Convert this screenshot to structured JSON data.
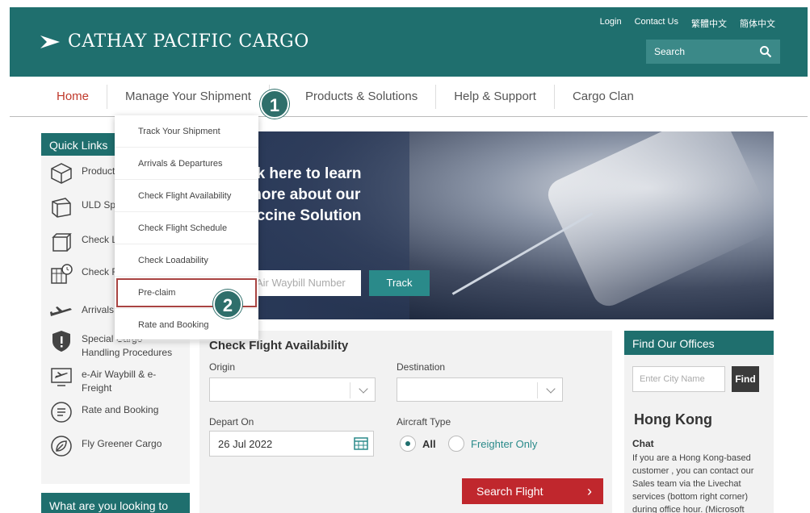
{
  "header": {
    "logo_text": "CATHAY PACIFIC CARGO",
    "top_links": [
      "Login",
      "Contact Us",
      "繁體中文",
      "簡体中文"
    ],
    "search_label": "Search"
  },
  "nav": {
    "items": [
      "Home",
      "Manage Your Shipment",
      "Products & Solutions",
      "Help & Support",
      "Cargo Clan"
    ]
  },
  "callouts": [
    "1",
    "2"
  ],
  "dropdown": {
    "items": [
      "Track Your Shipment",
      "Arrivals & Departures",
      "Check Flight Availability",
      "Check Flight Schedule",
      "Check Loadability",
      "Pre-claim",
      "Rate and Booking"
    ]
  },
  "quick_links": {
    "title": "Quick Links",
    "items": [
      "Product",
      "ULD Sp",
      "Check L",
      "Check F\nSchedu",
      "Arrivals",
      "Special Cargo\nHandling Procedures",
      "e-Air Waybill & e-\nFreight",
      "Rate and Booking",
      "Fly Greener Cargo"
    ],
    "looking": "What are you looking to"
  },
  "banner": {
    "text": "ck here to learn\nmore about our\naccine Solution",
    "awb_placeholder": "Air Waybill Number",
    "track_label": "Track"
  },
  "flight_availability": {
    "title": "Check Flight Availability",
    "origin_label": "Origin",
    "destination_label": "Destination",
    "depart_label": "Depart On",
    "depart_value": "26 Jul 2022",
    "aircraft_label": "Aircraft Type",
    "radio_all": "All",
    "radio_freighter": "Freighter Only",
    "search_label": "Search Flight"
  },
  "offices": {
    "title": "Find Our Offices",
    "city_placeholder": "Enter City Name",
    "find_label": "Find",
    "city": "Hong Kong",
    "chat_label": "Chat",
    "chat_text": "If you are a Hong Kong-based customer , you can contact our Sales team via the Livechat services (bottom right corner) during office hour. (Microsoft"
  }
}
